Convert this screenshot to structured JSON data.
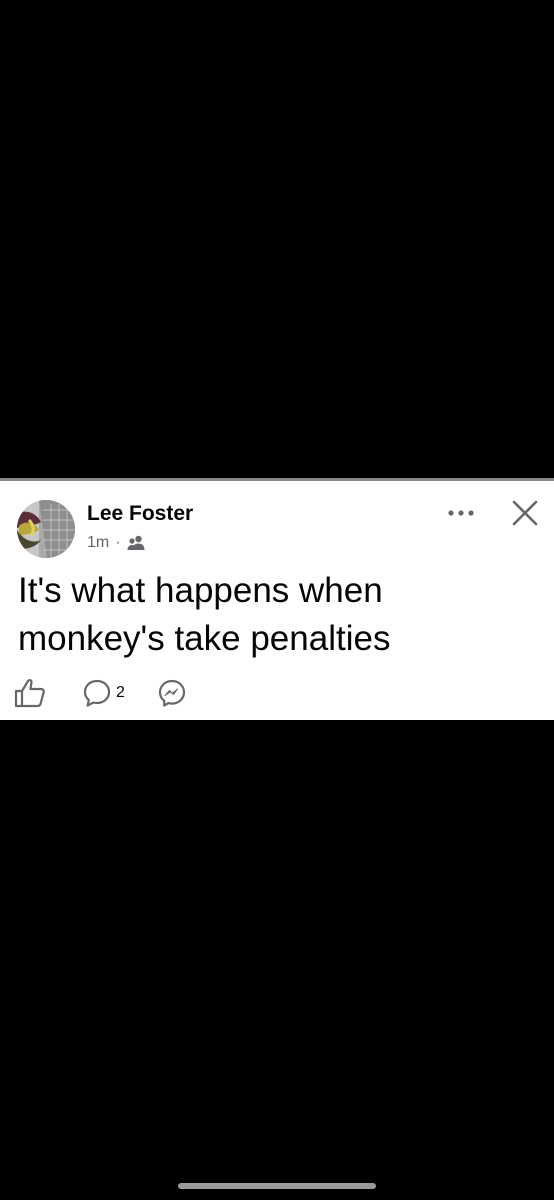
{
  "post": {
    "author": "Lee Foster",
    "time": "1m",
    "separator": "·",
    "audience_icon": "friends-audience-icon",
    "text": "It's what happens when monkey's take penalties",
    "comment_count": "2"
  },
  "icons": {
    "more": "more-options-icon",
    "close": "close-icon",
    "like": "thumbs-up-icon",
    "comment": "comment-icon",
    "share": "messenger-icon"
  },
  "colors": {
    "background": "#000000",
    "card": "#ffffff",
    "text_primary": "#050505",
    "text_secondary": "#65676b"
  }
}
